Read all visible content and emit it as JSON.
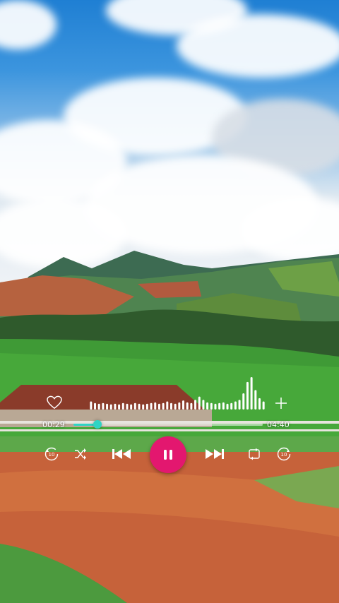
{
  "player": {
    "current_time": "00:29",
    "total_time": "04:40",
    "progress": 0.128,
    "state": "playing",
    "accent_color": "#e3176f",
    "progress_color": "#2fd4c4"
  },
  "icons": {
    "like": "heart-icon",
    "add": "plus-icon",
    "rewind": "rewind-10-icon",
    "shuffle": "shuffle-icon",
    "previous": "skip-previous-icon",
    "play_pause": "pause-icon",
    "next": "skip-next-icon",
    "repeat": "repeat-icon",
    "forward": "forward-10-icon"
  },
  "waveform_levels": [
    0.25,
    0.2,
    0.18,
    0.2,
    0.18,
    0.16,
    0.18,
    0.16,
    0.2,
    0.18,
    0.16,
    0.2,
    0.18,
    0.16,
    0.18,
    0.2,
    0.22,
    0.18,
    0.2,
    0.25,
    0.2,
    0.18,
    0.22,
    0.28,
    0.22,
    0.2,
    0.3,
    0.4,
    0.3,
    0.22,
    0.2,
    0.18,
    0.2,
    0.22,
    0.18,
    0.2,
    0.25,
    0.3,
    0.5,
    0.85,
    1.0,
    0.6,
    0.35,
    0.25
  ]
}
